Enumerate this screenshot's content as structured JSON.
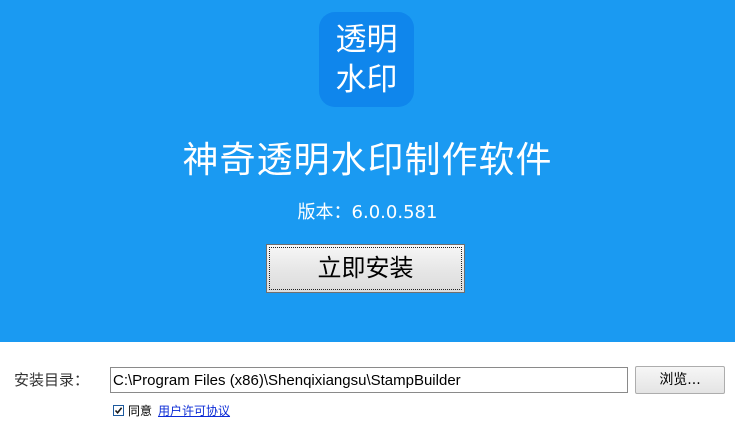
{
  "logo": {
    "line1": "透明",
    "line2": "水印"
  },
  "header": {
    "title": "神奇透明水印制作软件",
    "version": "版本：6.0.0.581"
  },
  "actions": {
    "install_label": "立即安装",
    "browse_label": "浏览..."
  },
  "install_dir": {
    "label": "安装目录：",
    "value": "C:\\Program Files (x86)\\Shenqixiangsu\\StampBuilder"
  },
  "agreement": {
    "checked": true,
    "agree_label": "同意",
    "license_link": "用户许可协议"
  },
  "colors": {
    "banner": "#1a9af2",
    "logo_bg": "#0f86ec",
    "link": "#0b2bd6"
  }
}
